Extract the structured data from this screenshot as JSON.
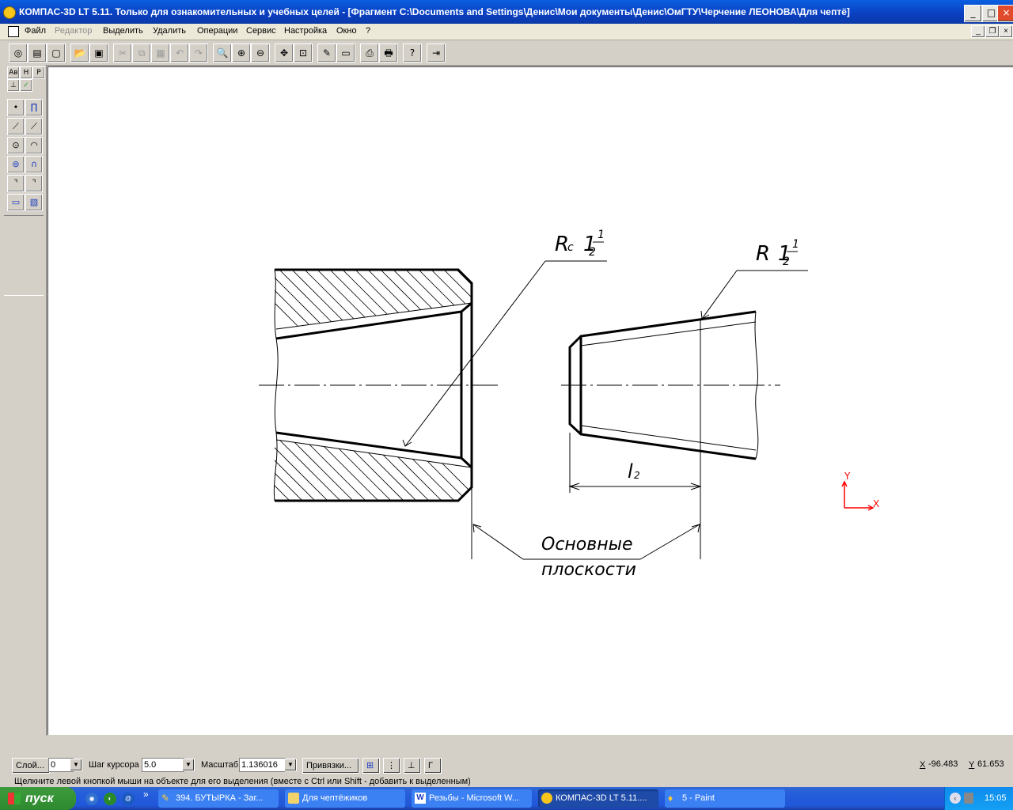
{
  "window": {
    "title": "КОМПАС-3D LT 5.11. Только для ознакомительных и учебных целей - [Фрагмент C:\\Documents and Settings\\Денис\\Мои документы\\Денис\\ОмГТУ\\Черчение ЛЕОНОВА\\Для чептё]"
  },
  "menu": {
    "items": [
      "Файл",
      "Редактор",
      "Выделить",
      "Удалить",
      "Операции",
      "Сервис",
      "Настройка",
      "Окно",
      "?"
    ],
    "disabled": [
      "Редактор"
    ]
  },
  "drawing": {
    "label_rc_letter": "R",
    "label_rc_sub": "c",
    "label_rc_whole": "1",
    "label_rc_num": "1",
    "label_rc_den": "2",
    "label_r_letter": "R",
    "label_r_whole": "1",
    "label_r_num": "1",
    "label_r_den": "2",
    "label_l": "l",
    "label_l_sub": "2",
    "label_planes_1": "Основные",
    "label_planes_2": "плоскости",
    "axis_y": "Y",
    "axis_x": "X",
    "line_color": "#000000",
    "axis_color": "#ff0000"
  },
  "bottom": {
    "layer_button": "Слой...",
    "layer_value": "0",
    "step_label": "Шаг курсора",
    "step_value": "5.0",
    "scale_label": "Масштаб",
    "scale_value": "1.136016",
    "snaps_button": "Привязки...",
    "x_label": "X",
    "x_value": "-96.483",
    "y_label": "Y",
    "y_value": "61.653"
  },
  "status": {
    "hint": "Щелкните левой кнопкой мыши на объекте для его выделения (вместе с Ctrl или Shift - добавить к выделенным)"
  },
  "taskbar": {
    "start": "пуск",
    "more": "»",
    "tasks": [
      {
        "label": "394. БУТЫРКА - Заг..."
      },
      {
        "label": "Для чептёжиков"
      },
      {
        "label": "Резьбы - Microsoft W..."
      },
      {
        "label": "КОМПАС-3D LT 5.11...."
      },
      {
        "label": "5 - Paint"
      }
    ],
    "clock": "15:05"
  }
}
